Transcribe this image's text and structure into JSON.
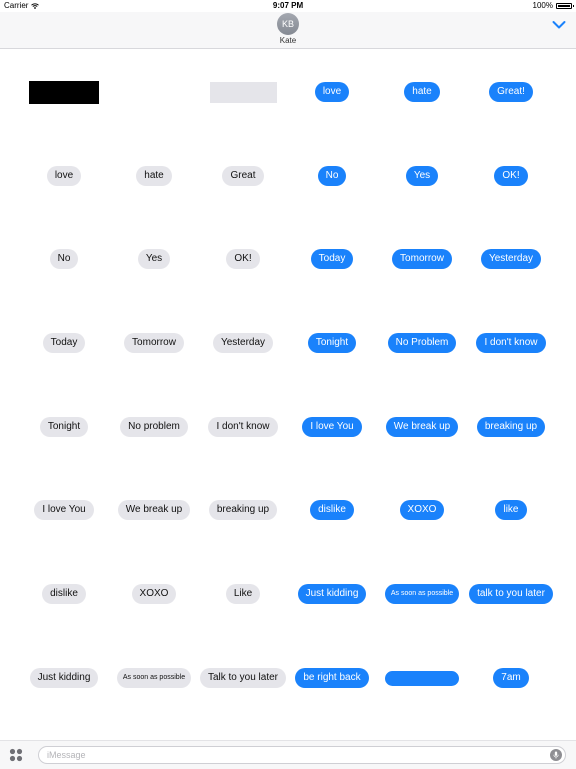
{
  "status_bar": {
    "carrier": "Carrier",
    "time": "9:07 PM",
    "battery": "100%"
  },
  "header": {
    "avatar_initials": "KB",
    "contact_name": "Kate"
  },
  "stickers": [
    {
      "label": "",
      "style": "black-rect"
    },
    {
      "label": "",
      "style": "empty"
    },
    {
      "label": "",
      "style": "gray-rect"
    },
    {
      "label": "love",
      "style": "blue"
    },
    {
      "label": "hate",
      "style": "blue"
    },
    {
      "label": "Great!",
      "style": "blue"
    },
    {
      "label": "love",
      "style": "gray"
    },
    {
      "label": "hate",
      "style": "gray"
    },
    {
      "label": "Great",
      "style": "gray"
    },
    {
      "label": "No",
      "style": "blue"
    },
    {
      "label": "Yes",
      "style": "blue"
    },
    {
      "label": "OK!",
      "style": "blue"
    },
    {
      "label": "No",
      "style": "gray"
    },
    {
      "label": "Yes",
      "style": "gray"
    },
    {
      "label": "OK!",
      "style": "gray"
    },
    {
      "label": "Today",
      "style": "blue"
    },
    {
      "label": "Tomorrow",
      "style": "blue"
    },
    {
      "label": "Yesterday",
      "style": "blue"
    },
    {
      "label": "Today",
      "style": "gray"
    },
    {
      "label": "Tomorrow",
      "style": "gray"
    },
    {
      "label": "Yesterday",
      "style": "gray"
    },
    {
      "label": "Tonight",
      "style": "blue"
    },
    {
      "label": "No Problem",
      "style": "blue"
    },
    {
      "label": "I don't know",
      "style": "blue"
    },
    {
      "label": "Tonight",
      "style": "gray"
    },
    {
      "label": "No problem",
      "style": "gray"
    },
    {
      "label": "I don't know",
      "style": "gray"
    },
    {
      "label": "I love You",
      "style": "blue"
    },
    {
      "label": "We break up",
      "style": "blue"
    },
    {
      "label": "breaking up",
      "style": "blue"
    },
    {
      "label": "I love You",
      "style": "gray"
    },
    {
      "label": "We break up",
      "style": "gray"
    },
    {
      "label": "breaking up",
      "style": "gray"
    },
    {
      "label": "dislike",
      "style": "blue"
    },
    {
      "label": "XOXO",
      "style": "blue"
    },
    {
      "label": "like",
      "style": "blue"
    },
    {
      "label": "dislike",
      "style": "gray"
    },
    {
      "label": "XOXO",
      "style": "gray"
    },
    {
      "label": "Like",
      "style": "gray"
    },
    {
      "label": "Just kidding",
      "style": "blue"
    },
    {
      "label": "As soon as possible",
      "style": "blue-small"
    },
    {
      "label": "talk to you later",
      "style": "blue"
    },
    {
      "label": "Just kidding",
      "style": "gray"
    },
    {
      "label": "As soon as possible",
      "style": "gray-small"
    },
    {
      "label": "Talk to you later",
      "style": "gray"
    },
    {
      "label": "be right back",
      "style": "blue"
    },
    {
      "label": "",
      "style": "blue-blank"
    },
    {
      "label": "7am",
      "style": "blue"
    }
  ],
  "input_bar": {
    "placeholder": "iMessage",
    "value": ""
  },
  "colors": {
    "bubble_blue": "#1a82fb",
    "bubble_gray": "#e5e5ea",
    "accent": "#1a82fb"
  }
}
